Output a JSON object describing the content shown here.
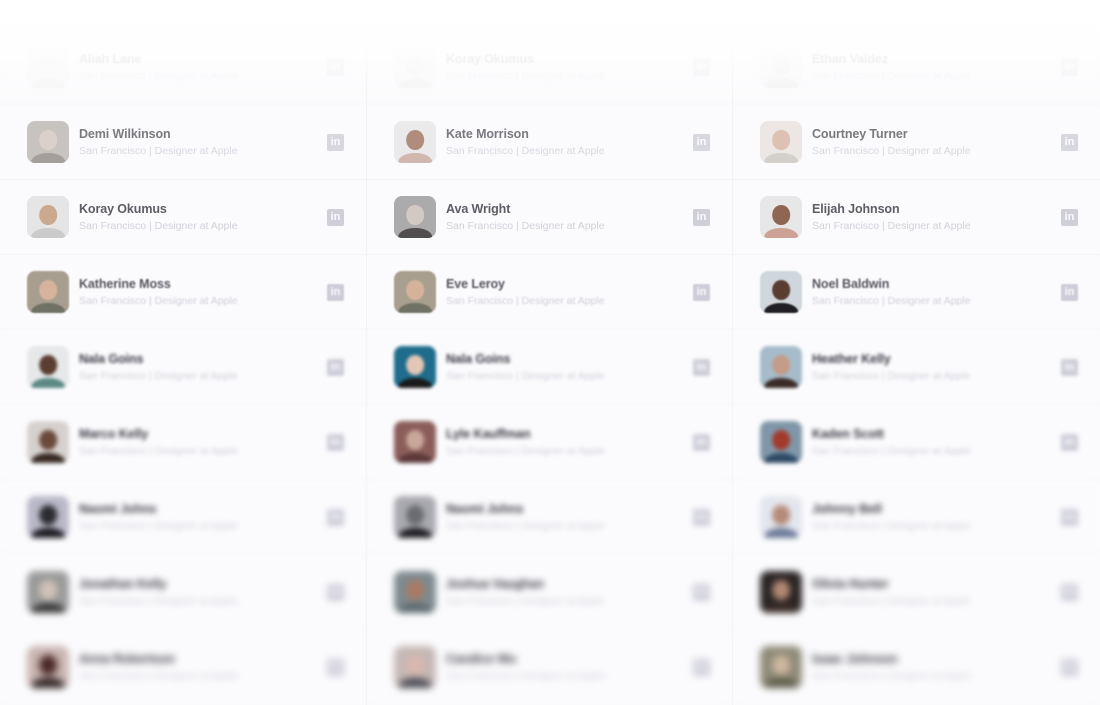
{
  "subtitle_default": "San Francisco | Designer at Apple",
  "icon": {
    "name": "linkedin-icon",
    "glyph": "in",
    "color": "#cdcdd8"
  },
  "columns": [
    {
      "people": [
        {
          "name": "Aliah Lane",
          "subtitle": "San Francisco | Designer at Apple",
          "avatar": {
            "bg": "#eeeeee",
            "skin": "#e6e1de",
            "shirt": "#dedede"
          }
        },
        {
          "name": "Demi Wilkinson",
          "subtitle": "San Francisco | Designer at Apple",
          "avatar": {
            "bg": "#b9b4b0",
            "skin": "#d3c6bf",
            "shirt": "#8e8682"
          }
        },
        {
          "name": "Koray Okumus",
          "subtitle": "San Francisco | Designer at Apple",
          "avatar": {
            "bg": "#e4e4e4",
            "skin": "#c9a58a",
            "shirt": "#c9c9c9"
          }
        },
        {
          "name": "Katherine Moss",
          "subtitle": "San Francisco | Designer at Apple",
          "avatar": {
            "bg": "#a79e8f",
            "skin": "#d8b39c",
            "shirt": "#6f7264"
          }
        },
        {
          "name": "Nala Goins",
          "subtitle": "San Francisco | Designer at Apple",
          "avatar": {
            "bg": "#e6e8ea",
            "skin": "#5b3d31",
            "shirt": "#5d8a84"
          }
        },
        {
          "name": "Marco Kelly",
          "subtitle": "San Francisco | Designer at Apple",
          "avatar": {
            "bg": "#d5d1ce",
            "skin": "#6b4a3c",
            "shirt": "#3a2a24"
          }
        },
        {
          "name": "Naomi Johns",
          "subtitle": "San Francisco | Designer at Apple",
          "avatar": {
            "bg": "#b8b8c8",
            "skin": "#2d2b32",
            "shirt": "#1b1a20"
          }
        },
        {
          "name": "Jonathan Kelly",
          "subtitle": "San Francisco | Designer at Apple",
          "avatar": {
            "bg": "#9a9a9a",
            "skin": "#cfc2b8",
            "shirt": "#3a3a3a"
          }
        },
        {
          "name": "Anna Robertson",
          "subtitle": "San Francisco | Designer at Apple",
          "avatar": {
            "bg": "#c9b5b0",
            "skin": "#4a2a28",
            "shirt": "#2a1e1e"
          }
        }
      ]
    },
    {
      "people": [
        {
          "name": "Koray Okumus",
          "subtitle": "San Francisco | Designer at Apple",
          "avatar": {
            "bg": "#eeeeee",
            "skin": "#e0dbd6",
            "shirt": "#d8d8d8"
          }
        },
        {
          "name": "Kate Morrison",
          "subtitle": "San Francisco | Designer at Apple",
          "avatar": {
            "bg": "#e6e6e6",
            "skin": "#9b6e5a",
            "shirt": "#c7a59a"
          }
        },
        {
          "name": "Ava Wright",
          "subtitle": "San Francisco | Designer at Apple",
          "avatar": {
            "bg": "#a7a7a7",
            "skin": "#d0c6c1",
            "shirt": "#4a4446"
          }
        },
        {
          "name": "Eve Leroy",
          "subtitle": "San Francisco | Designer at Apple",
          "avatar": {
            "bg": "#a89f8e",
            "skin": "#d6b29b",
            "shirt": "#6f7264"
          }
        },
        {
          "name": "Nala Goins",
          "subtitle": "San Francisco | Designer at Apple",
          "avatar": {
            "bg": "#1f6c8c",
            "skin": "#e3c6b6",
            "shirt": "#1a1a1a"
          }
        },
        {
          "name": "Lyle Kauffman",
          "subtitle": "San Francisco | Designer at Apple",
          "avatar": {
            "bg": "#8a5d5a",
            "skin": "#c9a79a",
            "shirt": "#5a3a38"
          }
        },
        {
          "name": "Naomi Johns",
          "subtitle": "San Francisco | Designer at Apple",
          "avatar": {
            "bg": "#a9a9b0",
            "skin": "#6b6b72",
            "shirt": "#1e1c22"
          }
        },
        {
          "name": "Joshua Vaughan",
          "subtitle": "San Francisco | Designer at Apple",
          "avatar": {
            "bg": "#7e8a8e",
            "skin": "#a97a64",
            "shirt": "#5e6a6e"
          }
        },
        {
          "name": "Candice Wu",
          "subtitle": "San Francisco | Designer at Apple",
          "avatar": {
            "bg": "#c5b7b5",
            "skin": "#d9b8ae",
            "shirt": "#4a4a52"
          }
        }
      ]
    },
    {
      "people": [
        {
          "name": "Ethan Valdez",
          "subtitle": "San Francisco | Designer at Apple",
          "avatar": {
            "bg": "#ececec",
            "skin": "#d9d4d0",
            "shirt": "#d3d3d3"
          }
        },
        {
          "name": "Courtney Turner",
          "subtitle": "San Francisco | Designer at Apple",
          "avatar": {
            "bg": "#e8e2de",
            "skin": "#d7b29d",
            "shirt": "#c9c3be"
          }
        },
        {
          "name": "Elijah Johnson",
          "subtitle": "San Francisco | Designer at Apple",
          "avatar": {
            "bg": "#e6e6e6",
            "skin": "#8a5e4c",
            "shirt": "#c99e90"
          }
        },
        {
          "name": "Noel Baldwin",
          "subtitle": "San Francisco | Designer at Apple",
          "avatar": {
            "bg": "#cfd6dc",
            "skin": "#5a3d31",
            "shirt": "#1e1e24"
          }
        },
        {
          "name": "Heather Kelly",
          "subtitle": "San Francisco | Designer at Apple",
          "avatar": {
            "bg": "#a6bccb",
            "skin": "#c49c88",
            "shirt": "#3b2b28"
          }
        },
        {
          "name": "Kaden Scott",
          "subtitle": "San Francisco | Designer at Apple",
          "avatar": {
            "bg": "#7f97a8",
            "skin": "#a33a2e",
            "shirt": "#2e4a66"
          }
        },
        {
          "name": "Johnny Bell",
          "subtitle": "San Francisco | Designer at Apple",
          "avatar": {
            "bg": "#e4e6ee",
            "skin": "#b48a78",
            "shirt": "#6b7a99"
          }
        },
        {
          "name": "Olivia Hunter",
          "subtitle": "San Francisco | Designer at Apple",
          "avatar": {
            "bg": "#2a2424",
            "skin": "#b08874",
            "shirt": "#3a2c28"
          }
        },
        {
          "name": "Isaac Johnson",
          "subtitle": "San Francisco | Designer at Apple",
          "avatar": {
            "bg": "#8e8a78",
            "skin": "#cdb7a0",
            "shirt": "#5d5a48"
          }
        }
      ]
    }
  ]
}
